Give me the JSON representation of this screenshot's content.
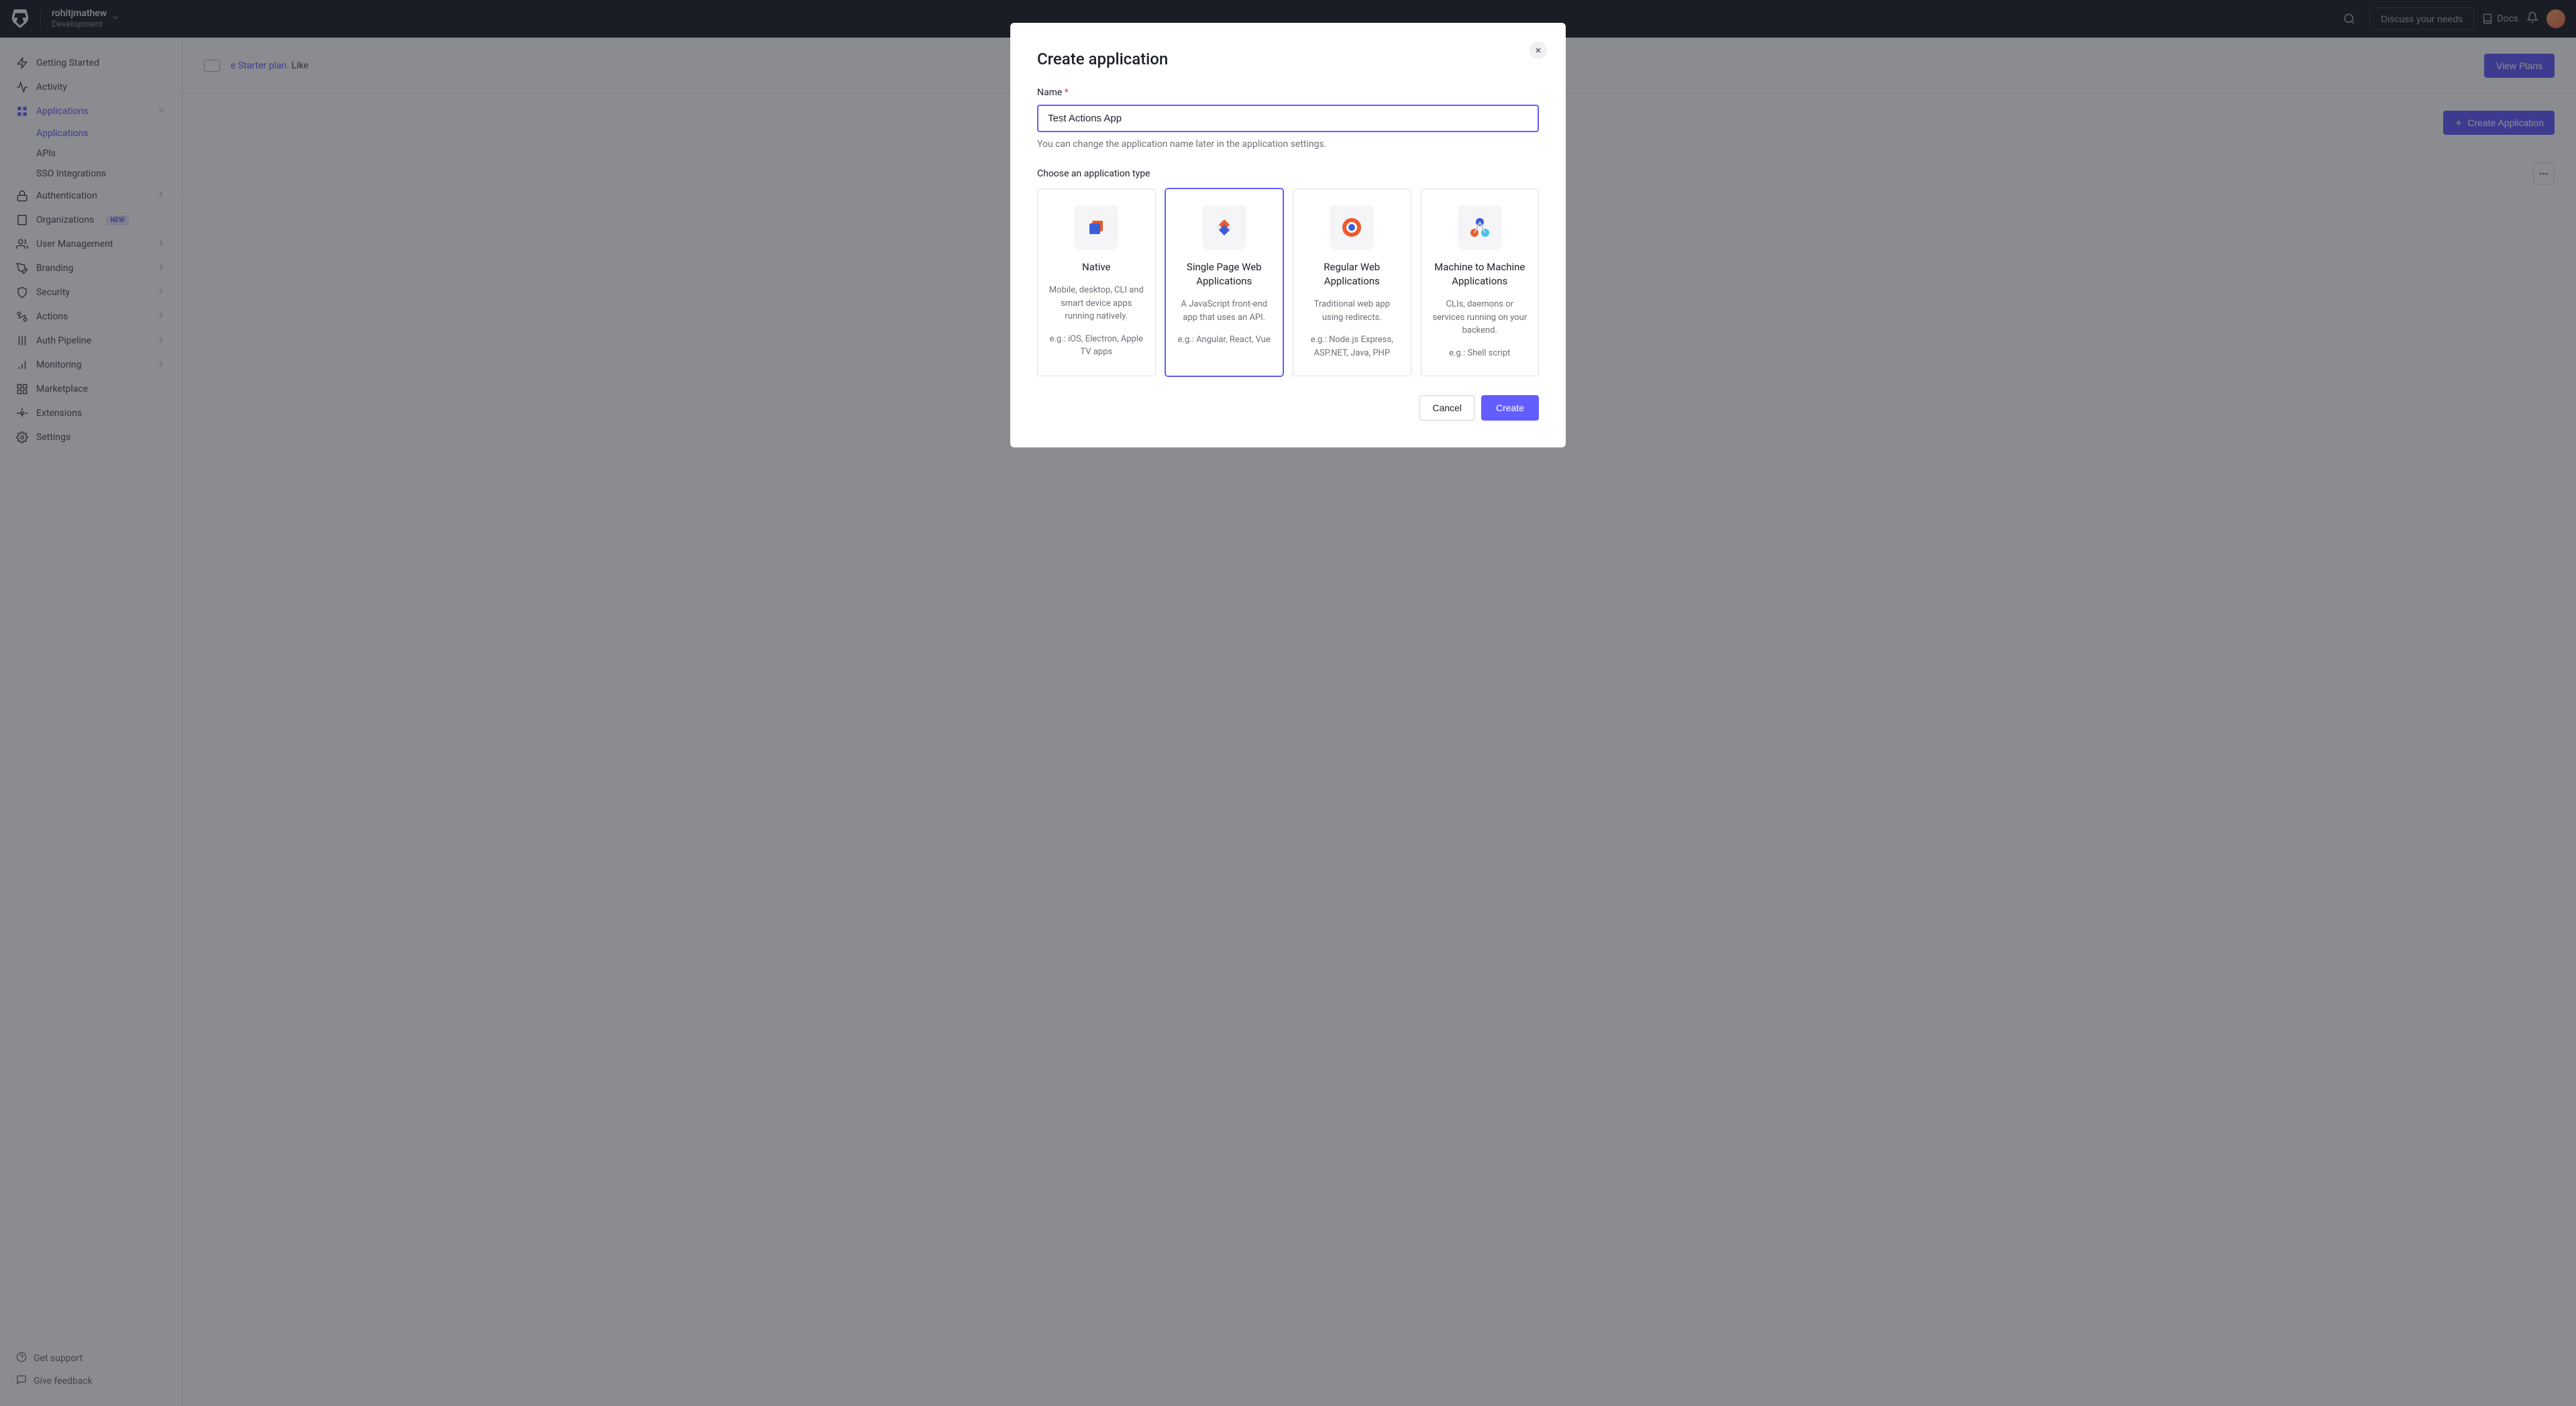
{
  "topbar": {
    "tenant_name": "rohitjmathew",
    "tenant_env": "Development",
    "discuss_label": "Discuss your needs",
    "docs_label": "Docs"
  },
  "sidebar": {
    "items": [
      {
        "label": "Getting Started"
      },
      {
        "label": "Activity"
      },
      {
        "label": "Applications"
      },
      {
        "label": "Authentication"
      },
      {
        "label": "Organizations"
      },
      {
        "label": "User Management"
      },
      {
        "label": "Branding"
      },
      {
        "label": "Security"
      },
      {
        "label": "Actions"
      },
      {
        "label": "Auth Pipeline"
      },
      {
        "label": "Monitoring"
      },
      {
        "label": "Marketplace"
      },
      {
        "label": "Extensions"
      },
      {
        "label": "Settings"
      }
    ],
    "sub_apps": [
      {
        "label": "Applications"
      },
      {
        "label": "APIs"
      },
      {
        "label": "SSO Integrations"
      }
    ],
    "new_badge": "NEW",
    "footer": {
      "support": "Get support",
      "feedback": "Give feedback"
    }
  },
  "banner": {
    "text_suffix": "e Starter plan",
    "like": ". Like",
    "view_plans": "View Plans"
  },
  "main": {
    "create_app_label": "Create Application"
  },
  "modal": {
    "title": "Create application",
    "name_label": "Name",
    "name_value": "Test Actions App",
    "name_help": "You can change the application name later in the application settings.",
    "type_label": "Choose an application type",
    "types": [
      {
        "name": "Native",
        "desc": "Mobile, desktop, CLI and smart device apps running natively.",
        "eg": "e.g.: iOS, Electron, Apple TV apps"
      },
      {
        "name": "Single Page Web Applications",
        "desc": "A JavaScript front-end app that uses an API.",
        "eg": "e.g.: Angular, React, Vue"
      },
      {
        "name": "Regular Web Applications",
        "desc": "Traditional web app using redirects.",
        "eg": "e.g.: Node.js Express, ASP.NET, Java, PHP"
      },
      {
        "name": "Machine to Machine Applications",
        "desc": "CLIs, daemons or services running on your backend.",
        "eg": "e.g.: Shell script"
      }
    ],
    "cancel": "Cancel",
    "create": "Create"
  }
}
